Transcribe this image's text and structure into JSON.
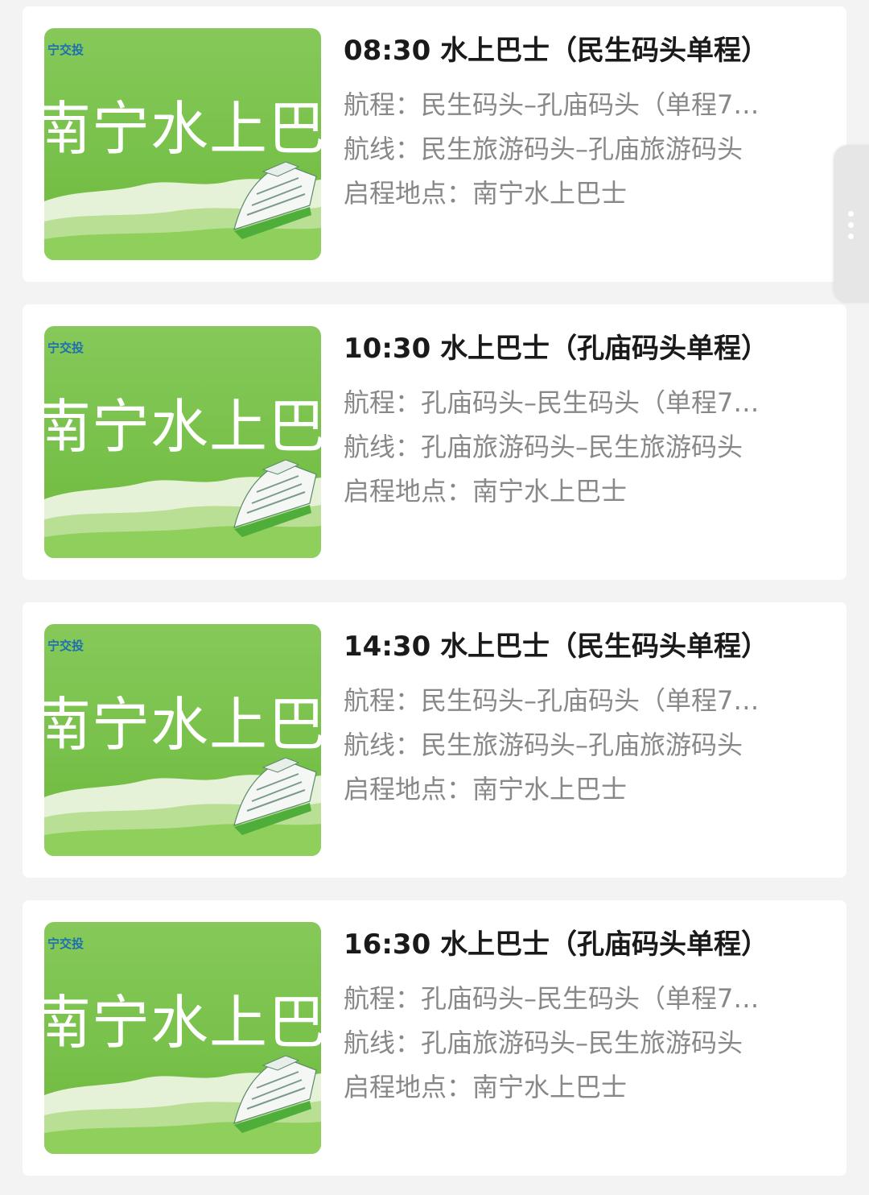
{
  "cards": [
    {
      "title": "08:30 水上巴士（民生码头单程）",
      "route": "航程：民生码头–孔庙码头（单程7…",
      "line": "航线：民生旅游码头–孔庙旅游码头",
      "start": "启程地点：南宁水上巴士",
      "thumb_logo": "宁交投",
      "thumb_text": "南宁水上巴士"
    },
    {
      "title": "10:30 水上巴士（孔庙码头单程）",
      "route": "航程：孔庙码头–民生码头（单程7…",
      "line": "航线：孔庙旅游码头–民生旅游码头",
      "start": "启程地点：南宁水上巴士",
      "thumb_logo": "宁交投",
      "thumb_text": "南宁水上巴士"
    },
    {
      "title": "14:30 水上巴士（民生码头单程）",
      "route": "航程：民生码头–孔庙码头（单程7…",
      "line": "航线：民生旅游码头–孔庙旅游码头",
      "start": "启程地点：南宁水上巴士",
      "thumb_logo": "宁交投",
      "thumb_text": "南宁水上巴士"
    },
    {
      "title": "16:30 水上巴士（孔庙码头单程）",
      "route": "航程：孔庙码头–民生码头（单程7…",
      "line": "航线：孔庙旅游码头–民生旅游码头",
      "start": "启程地点：南宁水上巴士",
      "thumb_logo": "宁交投",
      "thumb_text": "南宁水上巴士"
    }
  ],
  "side_handle": {
    "icon": "more-vertical-icon"
  },
  "colors": {
    "background": "#f3f3f3",
    "card": "#ffffff",
    "title_text": "#1a1a1a",
    "secondary_text": "#888888",
    "thumb_green": "#78c14a",
    "thumb_logo": "#1f6fb0"
  }
}
